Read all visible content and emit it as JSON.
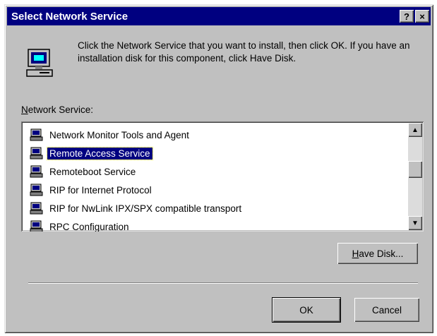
{
  "window": {
    "title": "Select Network Service",
    "help_button": "?",
    "close_button": "×"
  },
  "intro_text": "Click the Network Service that you want to install, then click OK.  If you have an installation disk for this component, click Have Disk.",
  "list": {
    "label_prefix": "N",
    "label_rest": "etwork Service:",
    "items": [
      {
        "label": "Network Monitor Tools and Agent",
        "selected": false
      },
      {
        "label": "Remote Access Service",
        "selected": true
      },
      {
        "label": "Remoteboot Service",
        "selected": false
      },
      {
        "label": "RIP for Internet Protocol",
        "selected": false
      },
      {
        "label": "RIP for NwLink IPX/SPX compatible transport",
        "selected": false
      },
      {
        "label": "RPC Configuration",
        "selected": false
      }
    ]
  },
  "buttons": {
    "have_disk_prefix": "H",
    "have_disk_rest": "ave Disk...",
    "ok": "OK",
    "cancel": "Cancel"
  },
  "icons": {
    "installer": "computer-install-icon",
    "list_item": "network-service-icon"
  },
  "colors": {
    "title_bar": "#000080",
    "face": "#c0c0c0",
    "selection": "#000080"
  }
}
